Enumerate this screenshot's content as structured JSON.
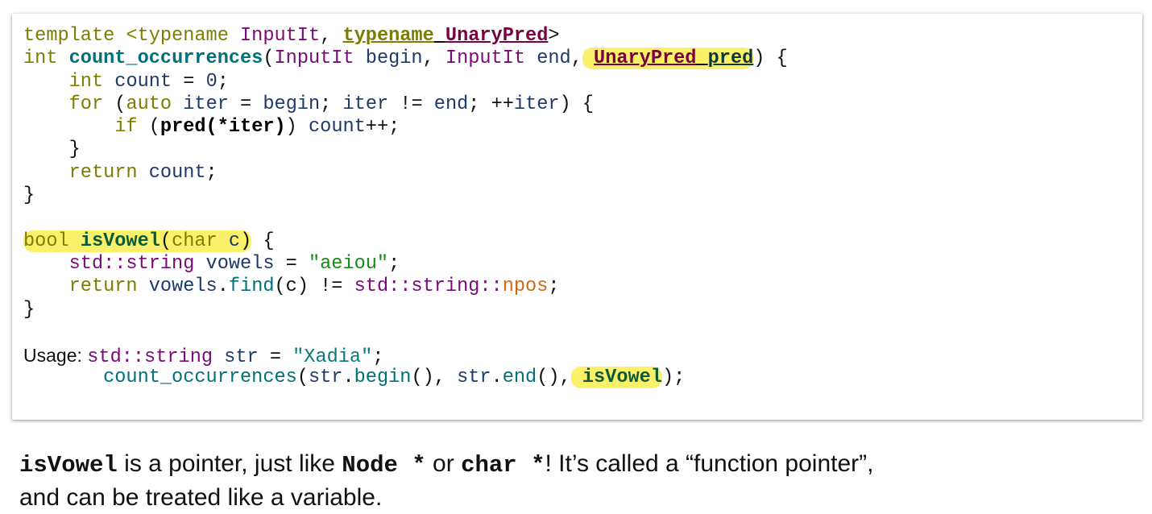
{
  "code_lines": [
    [
      [
        "template <typename ",
        "kw"
      ],
      [
        "InputIt",
        "ty"
      ],
      [
        ", ",
        ""
      ],
      [
        "typename",
        "kw b ul"
      ],
      [
        " ",
        "ul"
      ],
      [
        "UnaryPred",
        "ty b ul"
      ],
      [
        ">",
        ""
      ]
    ],
    [
      [
        "int ",
        "kw"
      ],
      [
        "count_occurrences",
        "fn"
      ],
      [
        "(",
        ""
      ],
      [
        "InputIt ",
        "ty"
      ],
      [
        "begin",
        "va"
      ],
      [
        ", ",
        ""
      ],
      [
        "InputIt ",
        "ty"
      ],
      [
        "end",
        "va"
      ],
      [
        ",",
        ""
      ],
      [
        " UnaryPred pred",
        "HL1"
      ],
      [
        ") {",
        ""
      ]
    ],
    [
      [
        "    int ",
        "kw"
      ],
      [
        "count",
        "va"
      ],
      [
        " = ",
        ""
      ],
      [
        "0",
        "num"
      ],
      [
        ";",
        ""
      ]
    ],
    [
      [
        "    for ",
        "kw"
      ],
      [
        "(",
        ""
      ],
      [
        "auto ",
        "kw"
      ],
      [
        "iter",
        "va"
      ],
      [
        " = ",
        ""
      ],
      [
        "begin",
        "va"
      ],
      [
        "; ",
        ""
      ],
      [
        "iter",
        "va"
      ],
      [
        " != ",
        ""
      ],
      [
        "end",
        "va"
      ],
      [
        "; ++",
        ""
      ],
      [
        "iter",
        "va"
      ],
      [
        ") {",
        ""
      ]
    ],
    [
      [
        "        if ",
        "kw"
      ],
      [
        "(",
        ""
      ],
      [
        "pred(*iter)",
        "bold"
      ],
      [
        ") ",
        ""
      ],
      [
        "count",
        "va"
      ],
      [
        "++;",
        ""
      ]
    ],
    [
      [
        "    }",
        ""
      ]
    ],
    [
      [
        "    return ",
        "kw"
      ],
      [
        "count",
        "va"
      ],
      [
        ";",
        ""
      ]
    ],
    [
      [
        "}",
        ""
      ]
    ],
    [
      [
        "",
        ""
      ]
    ],
    [
      [
        "bool ",
        "HL2"
      ],
      [
        "{",
        ""
      ]
    ],
    [
      [
        "    std::string ",
        "ty"
      ],
      [
        "vowels",
        "va"
      ],
      [
        " = ",
        ""
      ],
      [
        "\"aeiou\"",
        "str"
      ],
      [
        ";",
        ""
      ]
    ],
    [
      [
        "    return ",
        "kw"
      ],
      [
        "vowels",
        "va"
      ],
      [
        ".",
        ""
      ],
      [
        "find",
        "fnc"
      ],
      [
        "(c) != ",
        ""
      ],
      [
        "std::string::",
        "ty"
      ],
      [
        "npos",
        "np"
      ],
      [
        ";",
        ""
      ]
    ],
    [
      [
        "}",
        ""
      ]
    ],
    [
      [
        "",
        ""
      ]
    ],
    [
      [
        "Usage: ",
        "usage"
      ],
      [
        "std::string ",
        "ty"
      ],
      [
        "str",
        "va"
      ],
      [
        " = ",
        ""
      ],
      [
        "\"Xadia\"",
        "str2"
      ],
      [
        ";",
        ""
      ]
    ],
    [
      [
        "       count_occurrences",
        "fnc"
      ],
      [
        "(",
        ""
      ],
      [
        "str",
        "va"
      ],
      [
        ".",
        ""
      ],
      [
        "begin",
        "fnc"
      ],
      [
        "(), ",
        ""
      ],
      [
        "str",
        "va"
      ],
      [
        ".",
        ""
      ],
      [
        "end",
        "fnc"
      ],
      [
        "(),",
        ""
      ],
      [
        " isVowel",
        "HL3"
      ],
      [
        ");",
        ""
      ]
    ]
  ],
  "highlights": {
    "color": "#fbf06a"
  },
  "caption": {
    "t1": "isVowel",
    "t2": " is a pointer, just like ",
    "t3": "Node *",
    "t4": " or ",
    "t5": "char *",
    "t6": "!  It’s called a “function pointer”,",
    "t7": "and can be treated like a variable."
  }
}
